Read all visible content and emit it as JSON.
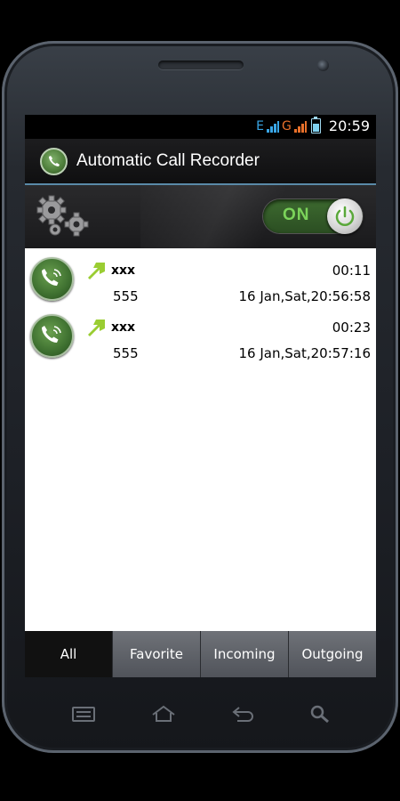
{
  "status_bar": {
    "network_1": "E",
    "network_2": "G",
    "time": "20:59"
  },
  "app": {
    "title": "Automatic Call Recorder"
  },
  "recording_toggle": {
    "label": "ON",
    "state": "on"
  },
  "calls": [
    {
      "name": "xxx",
      "duration": "00:11",
      "number": "555",
      "datetime": "16 Jan,Sat,20:56:58",
      "direction": "outgoing"
    },
    {
      "name": "xxx",
      "duration": "00:23",
      "number": "555",
      "datetime": "16 Jan,Sat,20:57:16",
      "direction": "outgoing"
    }
  ],
  "tabs": [
    {
      "label": "All",
      "active": true
    },
    {
      "label": "Favorite",
      "active": false
    },
    {
      "label": "Incoming",
      "active": false
    },
    {
      "label": "Outgoing",
      "active": false
    }
  ],
  "colors": {
    "accent_green": "#7bd35a",
    "arrow_green": "#9acd32",
    "title_divider": "#5a8aa8"
  },
  "softkeys": [
    "menu-icon",
    "home-icon",
    "back-icon",
    "search-icon"
  ]
}
